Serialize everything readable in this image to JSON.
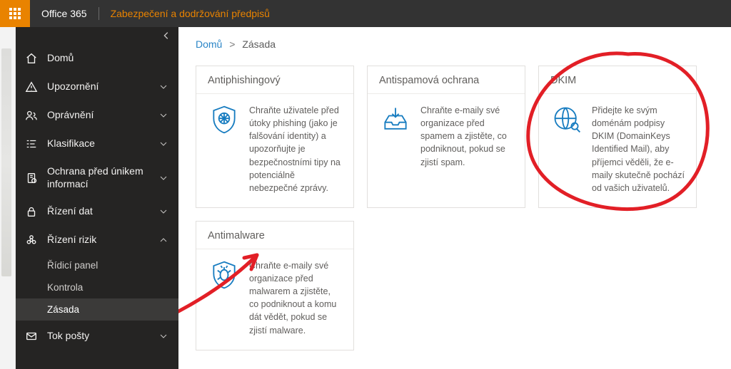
{
  "topbar": {
    "brand": "Office 365",
    "product": "Zabezpečení a dodržování předpisů"
  },
  "sidebar": {
    "items": [
      {
        "label": "Domů"
      },
      {
        "label": "Upozornění"
      },
      {
        "label": "Oprávnění"
      },
      {
        "label": "Klasifikace"
      },
      {
        "label": "Ochrana před únikem informací"
      },
      {
        "label": "Řízení dat"
      },
      {
        "label": "Řízení rizik"
      },
      {
        "label": "Tok pošty"
      }
    ],
    "subitems": [
      {
        "label": "Řídicí panel"
      },
      {
        "label": "Kontrola"
      },
      {
        "label": "Zásada"
      }
    ]
  },
  "breadcrumb": {
    "home": "Domů",
    "current": "Zásada"
  },
  "cards": [
    {
      "title": "Antiphishingový",
      "desc": "Chraňte uživatele před útoky phishing (jako je falšování identity) a upozorňujte je bezpečnostními tipy na potenciálně nebezpečné zprávy."
    },
    {
      "title": "Antispamová ochrana",
      "desc": "Chraňte e-maily své organizace před spamem a zjistěte, co podniknout, pokud se zjistí spam."
    },
    {
      "title": "DKIM",
      "desc": "Přidejte ke svým doménám podpisy DKIM (DomainKeys Identified Mail), aby příjemci věděli, že e-maily skutečně pochází od vašich uživatelů."
    },
    {
      "title": "Antimalware",
      "desc": "Chraňte e-maily své organizace před malwarem a zjistěte, co podniknout a komu dát vědět, pokud se zjistí malware."
    }
  ]
}
